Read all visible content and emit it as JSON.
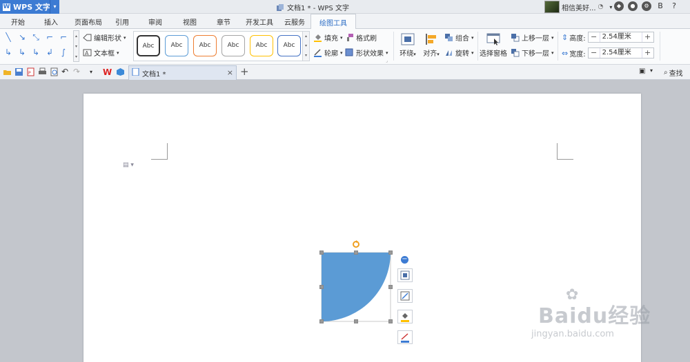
{
  "app": {
    "name": "WPS 文字",
    "logo_letter": "W"
  },
  "window": {
    "title": "文档1 * - WPS 文字"
  },
  "user": {
    "name": "相信美好..."
  },
  "tabs": [
    "开始",
    "插入",
    "页面布局",
    "引用",
    "审阅",
    "视图",
    "章节",
    "开发工具",
    "云服务",
    "绘图工具"
  ],
  "active_tab": "绘图工具",
  "ribbon": {
    "edit_shape": "编辑形状",
    "text_box": "文本框",
    "style_samples": [
      {
        "label": "Abc",
        "border": "#333333"
      },
      {
        "label": "Abc",
        "border": "#5b9bd5"
      },
      {
        "label": "Abc",
        "border": "#ed7d31"
      },
      {
        "label": "Abc",
        "border": "#a5a5a5"
      },
      {
        "label": "Abc",
        "border": "#ffc000"
      },
      {
        "label": "Abc",
        "border": "#4472c4"
      }
    ],
    "fill": "填充",
    "format_painter": "格式刷",
    "outline": "轮廓",
    "shape_effect": "形状效果",
    "wrap": "环绕",
    "align": "对齐",
    "group": "组合",
    "rotate": "旋转",
    "selection_pane": "选择窗格",
    "bring_forward": "上移一层",
    "send_backward": "下移一层",
    "height_label": "高度:",
    "height_value": "2.54厘米",
    "width_label": "宽度:",
    "width_value": "2.54厘米"
  },
  "doc_tab": {
    "name": "文档1 *"
  },
  "find": {
    "label": "查找"
  },
  "shape": {
    "type": "quarter-circle",
    "fill": "#5b9bd5"
  },
  "watermark": {
    "text": "Baidu经验",
    "url": "jingyan.baidu.com"
  }
}
